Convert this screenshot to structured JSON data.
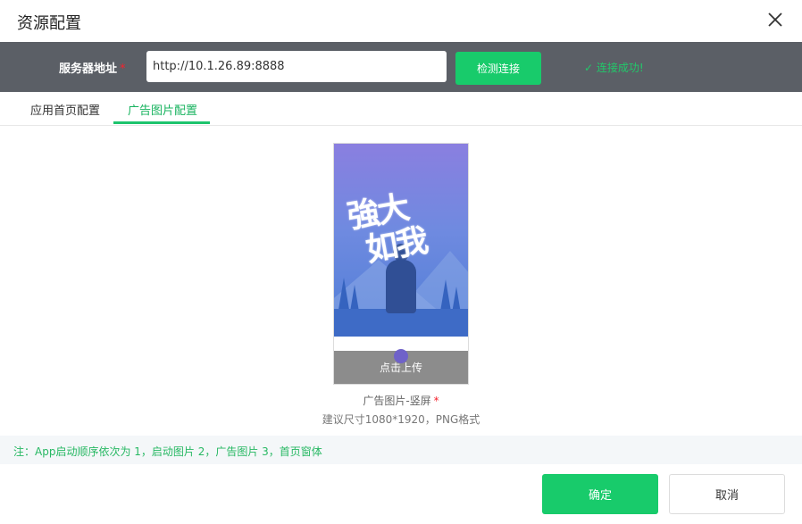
{
  "dialog": {
    "title": "资源配置",
    "close_icon": "close-icon"
  },
  "server": {
    "label": "服务器地址",
    "required_mark": "*",
    "address_value": "http://10.1.26.89:8888",
    "test_button_label": "检测连接",
    "status_text": "✓ 连接成功!",
    "status_color": "#22c86a"
  },
  "tabs": [
    {
      "label": "应用首页配置",
      "active": false
    },
    {
      "label": "广告图片配置",
      "active": true
    }
  ],
  "upload": {
    "poster_text_line1": "強大",
    "poster_text_line2": "如我",
    "upload_label": "点击上传",
    "upload_icon": "upload-icon",
    "caption": "广告图片-竖屏",
    "required_mark": "*",
    "hint": "建议尺寸1080*1920，PNG格式"
  },
  "note": "注：App启动顺序依次为 1，启动图片 2，广告图片 3，首页窗体",
  "footer": {
    "ok_label": "确定",
    "cancel_label": "取消"
  },
  "colors": {
    "accent_green": "#18cb6b",
    "server_bar": "#5b5f66",
    "required_red": "#f5222d"
  }
}
